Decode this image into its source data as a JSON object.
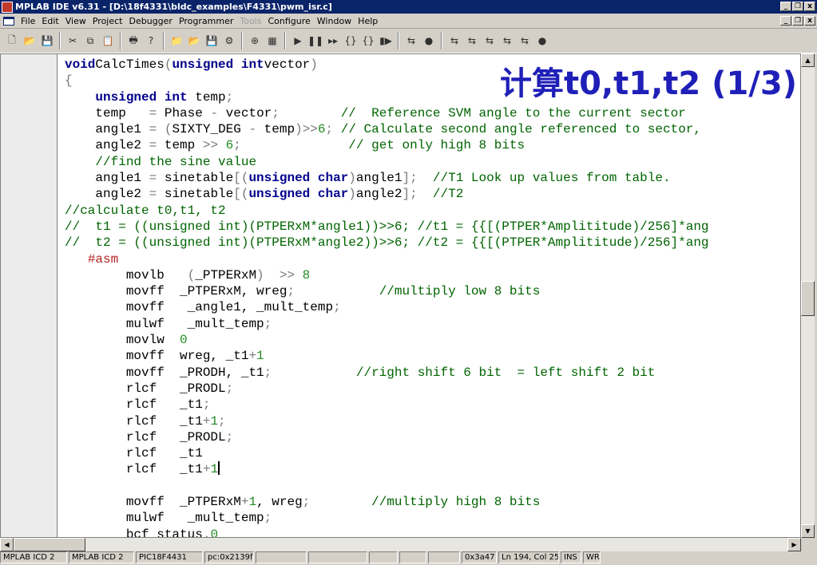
{
  "window": {
    "title": "MPLAB IDE v6.31 - [D:\\18f4331\\bldc_examples\\F4331\\pwm_isr.c]",
    "controls": [
      "_",
      "❐",
      "x"
    ],
    "doc_controls": [
      "_",
      "❐",
      "x"
    ]
  },
  "menu": [
    {
      "label": "File"
    },
    {
      "label": "Edit"
    },
    {
      "label": "View"
    },
    {
      "label": "Project"
    },
    {
      "label": "Debugger"
    },
    {
      "label": "Programmer"
    },
    {
      "label": "Tools",
      "disabled": true
    },
    {
      "label": "Configure"
    },
    {
      "label": "Window"
    },
    {
      "label": "Help"
    }
  ],
  "toolbar": {
    "icons": [
      {
        "name": "new-file-icon",
        "glyph": "🗋"
      },
      {
        "name": "open-file-icon",
        "glyph": "📂"
      },
      {
        "name": "save-icon",
        "glyph": "💾"
      },
      {
        "sep": true
      },
      {
        "name": "cut-icon",
        "glyph": "✂"
      },
      {
        "name": "copy-icon",
        "glyph": "⧉"
      },
      {
        "name": "paste-icon",
        "glyph": "📋"
      },
      {
        "sep": true
      },
      {
        "name": "print-icon",
        "glyph": "🖶"
      },
      {
        "name": "help-icon",
        "glyph": "?"
      },
      {
        "sep": true
      },
      {
        "name": "new-project-icon",
        "glyph": "📁"
      },
      {
        "name": "open-project-icon",
        "glyph": "📂"
      },
      {
        "name": "save-project-icon",
        "glyph": "💾"
      },
      {
        "name": "build-icon",
        "glyph": "⚙"
      },
      {
        "sep": true
      },
      {
        "name": "checksum-icon",
        "glyph": "⊕"
      },
      {
        "name": "memory-icon",
        "glyph": "▦"
      },
      {
        "sep": true
      },
      {
        "name": "run-icon",
        "glyph": "▶"
      },
      {
        "name": "halt-icon",
        "glyph": "❚❚"
      },
      {
        "name": "animate-icon",
        "glyph": "▸▸"
      },
      {
        "name": "step-into-icon",
        "glyph": "{}"
      },
      {
        "name": "step-over-icon",
        "glyph": "{}"
      },
      {
        "name": "reset-icon",
        "glyph": "▮▶"
      },
      {
        "sep": true
      },
      {
        "name": "debugger-connect-icon",
        "glyph": "⇆"
      },
      {
        "name": "debugger-target-icon",
        "glyph": "●"
      },
      {
        "sep": true
      },
      {
        "name": "program-device-icon",
        "glyph": "⇆"
      },
      {
        "name": "read-device-icon",
        "glyph": "⇆"
      },
      {
        "name": "verify-device-icon",
        "glyph": "⇆"
      },
      {
        "name": "erase-device-icon",
        "glyph": "⇆"
      },
      {
        "name": "blank-check-icon",
        "glyph": "⇆"
      },
      {
        "name": "programmer-target-icon",
        "glyph": "●"
      }
    ]
  },
  "overlay_title": "计算t0,t1,t2 (1/3)",
  "code_lines": [
    [
      [
        "kw",
        "void"
      ],
      [
        "",
        "CalcTimes"
      ],
      [
        "op",
        "("
      ],
      [
        "kw",
        "unsigned int"
      ],
      [
        "",
        "vector"
      ],
      [
        "op",
        ")"
      ]
    ],
    [
      [
        "op",
        "{"
      ]
    ],
    [
      [
        "",
        "    "
      ],
      [
        "kw",
        "unsigned int"
      ],
      [
        "",
        " temp"
      ],
      [
        "op",
        ";"
      ]
    ],
    [
      [
        "",
        "    temp   "
      ],
      [
        "op",
        "="
      ],
      [
        "",
        " Phase "
      ],
      [
        "op",
        "-"
      ],
      [
        "",
        " vector"
      ],
      [
        "op",
        ";"
      ],
      [
        "",
        "        "
      ],
      [
        "cm",
        "//  Reference SVM angle to the current sector"
      ]
    ],
    [
      [
        "",
        "    angle1 "
      ],
      [
        "op",
        "="
      ],
      [
        "",
        " "
      ],
      [
        "op",
        "("
      ],
      [
        "",
        "SIXTY_DEG "
      ],
      [
        "op",
        "-"
      ],
      [
        "",
        " temp"
      ],
      [
        "op",
        ")>>"
      ],
      [
        "num",
        "6"
      ],
      [
        "op",
        ";"
      ],
      [
        "",
        " "
      ],
      [
        "cm",
        "// Calculate second angle referenced to sector,"
      ]
    ],
    [
      [
        "",
        "    angle2 "
      ],
      [
        "op",
        "="
      ],
      [
        "",
        " temp "
      ],
      [
        "op",
        ">>"
      ],
      [
        "",
        " "
      ],
      [
        "num",
        "6"
      ],
      [
        "op",
        ";"
      ],
      [
        "",
        "              "
      ],
      [
        "cm",
        "// get only high 8 bits"
      ]
    ],
    [
      [
        "",
        "    "
      ],
      [
        "cm",
        "//find the sine value"
      ]
    ],
    [
      [
        "",
        "    angle1 "
      ],
      [
        "op",
        "="
      ],
      [
        "",
        " sinetable"
      ],
      [
        "op",
        "[("
      ],
      [
        "kw",
        "unsigned char"
      ],
      [
        "op",
        ")"
      ],
      [
        "",
        "angle1"
      ],
      [
        "op",
        "];"
      ],
      [
        "",
        "  "
      ],
      [
        "cm",
        "//T1 Look up values from table."
      ]
    ],
    [
      [
        "",
        "    angle2 "
      ],
      [
        "op",
        "="
      ],
      [
        "",
        " sinetable"
      ],
      [
        "op",
        "[("
      ],
      [
        "kw",
        "unsigned char"
      ],
      [
        "op",
        ")"
      ],
      [
        "",
        "angle2"
      ],
      [
        "op",
        "];"
      ],
      [
        "",
        "  "
      ],
      [
        "cm",
        "//T2"
      ]
    ],
    [
      [
        "cm",
        "//calculate t0,t1, t2"
      ]
    ],
    [
      [
        "cm",
        "//  t1 = ((unsigned int)(PTPERxM*angle1))>>6; //t1 = {{[(PTPER*Amplititude)/256]*ang"
      ]
    ],
    [
      [
        "cm",
        "//  t2 = ((unsigned int)(PTPERxM*angle2))>>6; //t2 = {{[(PTPER*Amplititude)/256]*ang"
      ]
    ],
    [
      [
        "",
        "   "
      ],
      [
        "pp",
        "#asm"
      ]
    ],
    [
      [
        "",
        "        movlb   "
      ],
      [
        "op",
        "("
      ],
      [
        "",
        "_PTPERxM"
      ],
      [
        "op",
        ")  >>"
      ],
      [
        "",
        " "
      ],
      [
        "num",
        "8"
      ]
    ],
    [
      [
        "",
        "        movff  _PTPERxM, wreg"
      ],
      [
        "op",
        ";"
      ],
      [
        "",
        "           "
      ],
      [
        "cm",
        "//multiply low 8 bits"
      ]
    ],
    [
      [
        "",
        "        movff   _angle1, _mult_temp"
      ],
      [
        "op",
        ";"
      ]
    ],
    [
      [
        "",
        "        mulwf   _mult_temp"
      ],
      [
        "op",
        ";"
      ]
    ],
    [
      [
        "",
        "        movlw  "
      ],
      [
        "num",
        "0"
      ]
    ],
    [
      [
        "",
        "        movff  wreg, _t1"
      ],
      [
        "op",
        "+"
      ],
      [
        "num",
        "1"
      ]
    ],
    [
      [
        "",
        "        movff  _PRODH, _t1"
      ],
      [
        "op",
        ";"
      ],
      [
        "",
        "           "
      ],
      [
        "cm",
        "//right shift 6 bit  = left shift 2 bit"
      ]
    ],
    [
      [
        "",
        "        rlcf   _PRODL"
      ],
      [
        "op",
        ";"
      ]
    ],
    [
      [
        "",
        "        rlcf   _t1"
      ],
      [
        "op",
        ";"
      ]
    ],
    [
      [
        "",
        "        rlcf   _t1"
      ],
      [
        "op",
        "+"
      ],
      [
        "num",
        "1"
      ],
      [
        "op",
        ";"
      ]
    ],
    [
      [
        "",
        "        rlcf   _PRODL"
      ],
      [
        "op",
        ";"
      ]
    ],
    [
      [
        "",
        "        rlcf   _t1"
      ]
    ],
    [
      [
        "",
        "        rlcf   _t1"
      ],
      [
        "op",
        "+"
      ],
      [
        "num",
        "1"
      ],
      [
        "caret",
        ""
      ]
    ],
    [
      [
        "",
        ""
      ]
    ],
    [
      [
        "",
        "        movff  _PTPERxM"
      ],
      [
        "op",
        "+"
      ],
      [
        "num",
        "1"
      ],
      [
        "",
        ", wreg"
      ],
      [
        "op",
        ";"
      ],
      [
        "",
        "        "
      ],
      [
        "cm",
        "//multiply high 8 bits"
      ]
    ],
    [
      [
        "",
        "        mulwf   _mult_temp"
      ],
      [
        "op",
        ";"
      ]
    ],
    [
      [
        "",
        "        bcf status"
      ],
      [
        "op",
        "."
      ],
      [
        "num",
        "0"
      ]
    ]
  ],
  "statusbar": [
    {
      "text": "MPLAB ICD 2",
      "w": 84
    },
    {
      "text": "MPLAB ICD 2",
      "w": 82
    },
    {
      "text": "PIC18F4431",
      "w": 84
    },
    {
      "text": "pc:0x2139f",
      "w": 62
    },
    {
      "text": "",
      "w": 64
    },
    {
      "text": "",
      "w": 74
    },
    {
      "text": "",
      "w": 36
    },
    {
      "text": "",
      "w": 34
    },
    {
      "text": "",
      "w": 40
    },
    {
      "text": "0x3a47",
      "w": 44
    },
    {
      "text": "Ln 194, Col 25",
      "w": 76
    },
    {
      "text": "INS",
      "w": 26
    },
    {
      "text": "WR",
      "w": 22
    }
  ]
}
